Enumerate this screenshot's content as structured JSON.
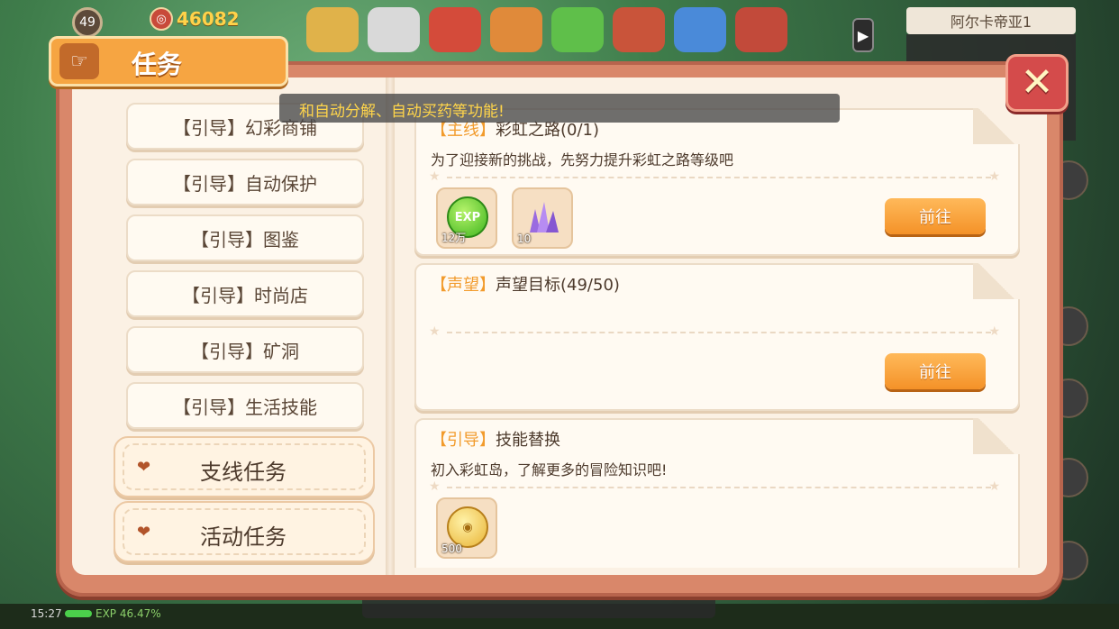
{
  "hud": {
    "level": "49",
    "coins": "46082",
    "map_name": "阿尔卡帝亚1",
    "clock": "15:27",
    "exp_text": "EXP 46.47%"
  },
  "panel": {
    "title": "任务",
    "close_glyph": "✕"
  },
  "toast": {
    "text": "和自动分解、自动买药等功能!"
  },
  "left_list": {
    "guide_items": [
      {
        "label": "【引导】幻彩商铺"
      },
      {
        "label": "【引导】自动保护"
      },
      {
        "label": "【引导】图鉴"
      },
      {
        "label": "【引导】时尚店"
      },
      {
        "label": "【引导】矿洞"
      },
      {
        "label": "【引导】生活技能"
      }
    ],
    "categories": [
      {
        "label": "支线任务"
      },
      {
        "label": "活动任务"
      }
    ]
  },
  "quests": [
    {
      "tag": "【主线】",
      "title": "彩虹之路(0/1)",
      "description": "为了迎接新的挑战，先努力提升彩虹之路等级吧",
      "go_label": "前往",
      "rewards": [
        {
          "icon": "exp-orb-icon",
          "label": "EXP",
          "count": "12万"
        },
        {
          "icon": "purple-crystal-icon",
          "label": "",
          "count": "10"
        }
      ]
    },
    {
      "tag": "【声望】",
      "title": "声望目标(49/50)",
      "description": "",
      "go_label": "前往",
      "rewards": []
    },
    {
      "tag": "【引导】",
      "title": "技能替换",
      "description": "初入彩虹岛，了解更多的冒险知识吧!",
      "go_label": "",
      "rewards": [
        {
          "icon": "gold-coin-icon",
          "label": "",
          "count": "500"
        }
      ]
    }
  ]
}
